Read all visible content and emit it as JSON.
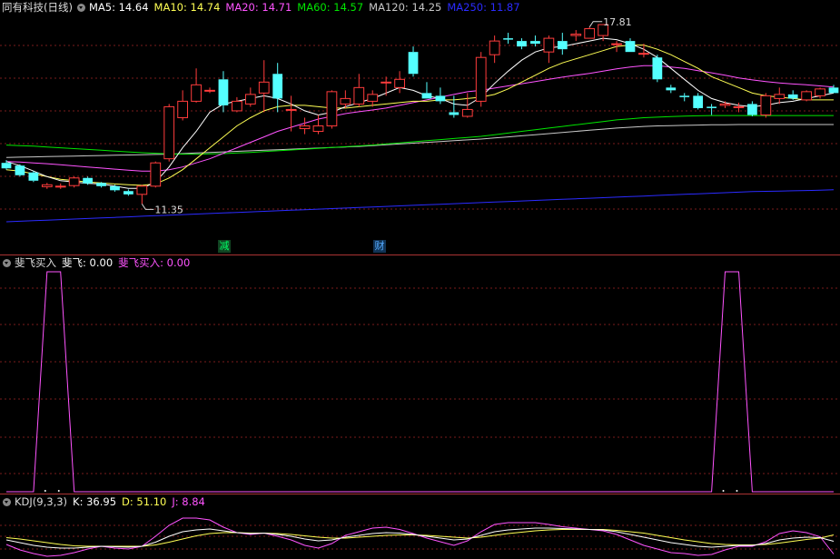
{
  "colors": {
    "bg": "#000000",
    "up": "#ff3c3c",
    "down": "#54ffff",
    "ma5": "#ffffff",
    "ma10": "#ffff54",
    "ma20": "#ff54ff",
    "ma60": "#00e600",
    "ma120": "#c8c8c8",
    "ma250": "#2b2bff",
    "grid": "#7a1d1d",
    "k": "#ffffff",
    "d": "#ffff54",
    "j": "#ff54ff"
  },
  "main": {
    "title": "同有科技(日线)",
    "ma_labels": [
      {
        "text": "MA5: 14.64",
        "color": "#ffffff"
      },
      {
        "text": "MA10: 14.74",
        "color": "#ffff54"
      },
      {
        "text": "MA20: 14.71",
        "color": "#ff54ff"
      },
      {
        "text": "MA60: 14.57",
        "color": "#00e600"
      },
      {
        "text": "MA120: 14.25",
        "color": "#c8c8c8"
      },
      {
        "text": "MA250: 11.87",
        "color": "#2b2bff"
      }
    ],
    "high_label": "17.81",
    "low_label": "11.35",
    "event_tags": [
      {
        "text": "减",
        "color": "#00ff66",
        "bg": "#114422"
      },
      {
        "text": "财",
        "color": "#54aaff",
        "bg": "#113355"
      }
    ]
  },
  "indicator1": {
    "name": "斐飞买入",
    "labels": [
      {
        "text": "斐飞: 0.00",
        "color": "#ffffff"
      },
      {
        "text": "斐飞买入: 0.00",
        "color": "#ff54ff"
      }
    ]
  },
  "indicator2": {
    "name": "KDJ(9,3,3)",
    "labels": [
      {
        "text": "K: 36.95",
        "color": "#ffffff"
      },
      {
        "text": "D: 51.10",
        "color": "#ffff54"
      },
      {
        "text": "J: 8.84",
        "color": "#ff54ff"
      }
    ]
  },
  "chart_data": {
    "type": "candlestick",
    "ylim": [
      10.5,
      18.2
    ],
    "high": 17.81,
    "low": 11.35,
    "candles": [
      [
        12.85,
        12.95,
        12.6,
        12.65
      ],
      [
        12.75,
        12.8,
        12.35,
        12.4
      ],
      [
        12.5,
        12.55,
        12.15,
        12.2
      ],
      [
        11.98,
        12.12,
        11.9,
        12.05
      ],
      [
        11.98,
        12.1,
        11.9,
        12.0
      ],
      [
        12.02,
        12.35,
        11.95,
        12.3
      ],
      [
        12.3,
        12.35,
        12.05,
        12.1
      ],
      [
        12.12,
        12.15,
        11.95,
        12.0
      ],
      [
        12.0,
        12.05,
        11.8,
        11.85
      ],
      [
        11.82,
        11.88,
        11.65,
        11.7
      ],
      [
        11.7,
        12.05,
        11.35,
        12.0
      ],
      [
        12.0,
        12.9,
        11.95,
        12.85
      ],
      [
        13.0,
        15.0,
        12.9,
        14.9
      ],
      [
        14.5,
        15.5,
        14.4,
        15.1
      ],
      [
        15.1,
        16.3,
        15.05,
        15.7
      ],
      [
        15.5,
        15.6,
        15.4,
        15.5
      ],
      [
        15.9,
        16.2,
        14.7,
        14.95
      ],
      [
        14.75,
        15.25,
        14.7,
        15.1
      ],
      [
        15.0,
        15.6,
        14.9,
        15.35
      ],
      [
        15.4,
        16.6,
        14.7,
        15.8
      ],
      [
        16.1,
        16.5,
        14.7,
        15.2
      ],
      [
        14.8,
        15.3,
        14.0,
        14.8
      ],
      [
        14.1,
        14.5,
        13.9,
        14.2
      ],
      [
        14.0,
        14.6,
        13.9,
        14.2
      ],
      [
        14.2,
        15.5,
        14.1,
        15.45
      ],
      [
        15.0,
        15.5,
        14.85,
        15.2
      ],
      [
        15.0,
        16.1,
        14.9,
        15.6
      ],
      [
        15.1,
        15.5,
        14.9,
        15.35
      ],
      [
        15.8,
        16.0,
        15.3,
        15.8
      ],
      [
        15.6,
        16.2,
        15.4,
        15.9
      ],
      [
        16.9,
        17.1,
        16.0,
        16.1
      ],
      [
        15.4,
        15.8,
        15.2,
        15.2
      ],
      [
        15.3,
        15.6,
        15.0,
        15.1
      ],
      [
        14.7,
        15.3,
        14.5,
        14.6
      ],
      [
        14.55,
        15.4,
        14.5,
        14.8
      ],
      [
        15.1,
        16.9,
        14.9,
        16.7
      ],
      [
        16.8,
        17.5,
        16.5,
        17.3
      ],
      [
        17.4,
        17.6,
        17.2,
        17.35
      ],
      [
        17.3,
        17.4,
        17.0,
        17.1
      ],
      [
        17.3,
        17.5,
        17.1,
        17.2
      ],
      [
        16.9,
        17.5,
        16.5,
        17.4
      ],
      [
        17.3,
        17.6,
        16.8,
        17.0
      ],
      [
        17.5,
        17.7,
        17.3,
        17.55
      ],
      [
        17.4,
        17.81,
        17.4,
        17.75
      ],
      [
        17.5,
        17.75,
        17.3,
        17.9
      ],
      [
        17.2,
        17.3,
        16.9,
        17.2
      ],
      [
        17.3,
        17.4,
        16.9,
        16.9
      ],
      [
        16.85,
        17.2,
        16.7,
        16.85
      ],
      [
        16.7,
        16.8,
        15.8,
        15.9
      ],
      [
        15.6,
        15.7,
        15.4,
        15.5
      ],
      [
        15.3,
        15.4,
        15.1,
        15.25
      ],
      [
        15.3,
        15.4,
        14.8,
        14.85
      ],
      [
        14.9,
        15.0,
        14.6,
        14.85
      ],
      [
        14.95,
        15.1,
        14.85,
        15.0
      ],
      [
        14.9,
        15.05,
        14.7,
        14.9
      ],
      [
        15.0,
        15.1,
        14.55,
        14.6
      ],
      [
        14.6,
        15.4,
        14.5,
        15.3
      ],
      [
        15.2,
        15.6,
        15.0,
        15.35
      ],
      [
        15.35,
        15.5,
        15.15,
        15.2
      ],
      [
        15.15,
        15.5,
        15.1,
        15.45
      ],
      [
        15.3,
        15.6,
        15.2,
        15.55
      ],
      [
        15.6,
        15.7,
        15.4,
        15.4
      ]
    ],
    "ma5": [
      12.9,
      12.75,
      12.55,
      12.35,
      12.2,
      12.15,
      12.1,
      12.08,
      12.0,
      11.92,
      11.92,
      12.15,
      12.7,
      13.4,
      14.0,
      14.7,
      15.0,
      15.1,
      15.2,
      15.3,
      15.2,
      15.0,
      14.75,
      14.6,
      14.7,
      14.9,
      15.05,
      15.2,
      15.4,
      15.6,
      15.5,
      15.3,
      15.2,
      15.0,
      14.95,
      15.25,
      15.75,
      16.2,
      16.6,
      16.9,
      17.05,
      17.1,
      17.2,
      17.3,
      17.4,
      17.35,
      17.2,
      17.0,
      16.7,
      16.3,
      15.9,
      15.5,
      15.2,
      15.05,
      14.95,
      14.9,
      14.95,
      15.05,
      15.1,
      15.2,
      15.3,
      15.4
    ],
    "ma10": [
      12.6,
      12.55,
      12.45,
      12.35,
      12.25,
      12.2,
      12.15,
      12.12,
      12.08,
      12.05,
      12.03,
      12.08,
      12.3,
      12.6,
      13.0,
      13.4,
      13.8,
      14.2,
      14.5,
      14.75,
      14.9,
      14.95,
      14.95,
      14.9,
      14.85,
      14.85,
      14.9,
      14.95,
      15.0,
      15.05,
      15.1,
      15.1,
      15.15,
      15.15,
      15.2,
      15.25,
      15.35,
      15.55,
      15.8,
      16.05,
      16.3,
      16.5,
      16.65,
      16.8,
      16.95,
      17.1,
      17.15,
      17.15,
      17.0,
      16.8,
      16.55,
      16.3,
      16.0,
      15.8,
      15.6,
      15.4,
      15.3,
      15.25,
      15.2,
      15.15,
      15.15,
      15.15
    ],
    "ma20": [
      12.9,
      12.88,
      12.85,
      12.82,
      12.78,
      12.74,
      12.7,
      12.66,
      12.62,
      12.58,
      12.55,
      12.55,
      12.6,
      12.7,
      12.85,
      13.0,
      13.2,
      13.4,
      13.6,
      13.8,
      14.0,
      14.15,
      14.3,
      14.45,
      14.55,
      14.65,
      14.72,
      14.78,
      14.85,
      14.95,
      15.05,
      15.15,
      15.25,
      15.35,
      15.45,
      15.5,
      15.58,
      15.66,
      15.74,
      15.82,
      15.9,
      15.98,
      16.05,
      16.12,
      16.2,
      16.28,
      16.35,
      16.4,
      16.4,
      16.35,
      16.3,
      16.22,
      16.14,
      16.05,
      15.95,
      15.88,
      15.82,
      15.77,
      15.73,
      15.7,
      15.66,
      15.62
    ],
    "ma60": [
      13.5,
      13.48,
      13.46,
      13.43,
      13.4,
      13.37,
      13.34,
      13.31,
      13.28,
      13.25,
      13.22,
      13.2,
      13.18,
      13.17,
      13.17,
      13.18,
      13.19,
      13.21,
      13.23,
      13.26,
      13.29,
      13.32,
      13.35,
      13.38,
      13.41,
      13.44,
      13.47,
      13.5,
      13.54,
      13.58,
      13.62,
      13.66,
      13.7,
      13.74,
      13.78,
      13.82,
      13.88,
      13.94,
      14.0,
      14.06,
      14.12,
      14.18,
      14.24,
      14.3,
      14.36,
      14.42,
      14.46,
      14.5,
      14.52,
      14.54,
      14.56,
      14.57,
      14.58,
      14.58,
      14.58,
      14.58,
      14.58,
      14.58,
      14.58,
      14.58,
      14.58,
      14.58
    ],
    "ma120": [
      13.05,
      13.06,
      13.07,
      13.08,
      13.09,
      13.1,
      13.11,
      13.12,
      13.13,
      13.14,
      13.15,
      13.16,
      13.17,
      13.19,
      13.21,
      13.23,
      13.25,
      13.27,
      13.29,
      13.31,
      13.33,
      13.35,
      13.37,
      13.39,
      13.41,
      13.43,
      13.45,
      13.48,
      13.51,
      13.54,
      13.57,
      13.6,
      13.63,
      13.66,
      13.69,
      13.72,
      13.76,
      13.8,
      13.84,
      13.88,
      13.92,
      13.96,
      14.0,
      14.04,
      14.08,
      14.12,
      14.15,
      14.18,
      14.2,
      14.21,
      14.22,
      14.23,
      14.24,
      14.24,
      14.25,
      14.25,
      14.25,
      14.25,
      14.25,
      14.25,
      14.25,
      14.25
    ],
    "ma250": [
      10.7,
      10.72,
      10.74,
      10.76,
      10.78,
      10.8,
      10.82,
      10.84,
      10.86,
      10.88,
      10.9,
      10.92,
      10.94,
      10.96,
      10.98,
      11.0,
      11.02,
      11.04,
      11.06,
      11.08,
      11.1,
      11.12,
      11.14,
      11.16,
      11.18,
      11.2,
      11.22,
      11.24,
      11.26,
      11.28,
      11.3,
      11.32,
      11.34,
      11.36,
      11.38,
      11.4,
      11.42,
      11.44,
      11.46,
      11.48,
      11.5,
      11.52,
      11.54,
      11.56,
      11.58,
      11.6,
      11.62,
      11.64,
      11.66,
      11.68,
      11.7,
      11.72,
      11.74,
      11.76,
      11.78,
      11.8,
      11.81,
      11.82,
      11.83,
      11.84,
      11.85,
      11.87
    ],
    "signal": [
      0,
      0,
      0,
      100,
      100,
      0,
      0,
      0,
      0,
      0,
      0,
      0,
      0,
      0,
      0,
      0,
      0,
      0,
      0,
      0,
      0,
      0,
      0,
      0,
      0,
      0,
      0,
      0,
      0,
      0,
      0,
      0,
      0,
      0,
      0,
      0,
      0,
      0,
      0,
      0,
      0,
      0,
      0,
      0,
      0,
      0,
      0,
      0,
      0,
      0,
      0,
      0,
      0,
      100,
      100,
      0,
      0,
      0,
      0,
      0,
      0,
      0
    ],
    "kdj_k": [
      40,
      34,
      28,
      24,
      22,
      22,
      24,
      26,
      25,
      24,
      26,
      35,
      48,
      58,
      62,
      64,
      60,
      56,
      54,
      55,
      52,
      48,
      42,
      38,
      40,
      46,
      50,
      54,
      56,
      55,
      52,
      48,
      44,
      40,
      42,
      50,
      58,
      62,
      64,
      66,
      66,
      65,
      64,
      63,
      62,
      58,
      52,
      46,
      40,
      34,
      30,
      26,
      24,
      26,
      28,
      28,
      32,
      40,
      44,
      46,
      45,
      37
    ],
    "kdj_d": [
      45,
      42,
      38,
      34,
      30,
      27,
      26,
      26,
      26,
      26,
      26,
      29,
      35,
      42,
      49,
      54,
      56,
      56,
      55,
      55,
      54,
      52,
      49,
      46,
      44,
      44,
      46,
      48,
      50,
      51,
      51,
      50,
      48,
      46,
      44,
      46,
      50,
      54,
      57,
      60,
      62,
      63,
      63,
      63,
      63,
      61,
      58,
      55,
      50,
      45,
      40,
      36,
      32,
      30,
      29,
      29,
      30,
      33,
      37,
      41,
      44,
      51
    ],
    "kdj_j": [
      30,
      18,
      10,
      4,
      6,
      12,
      20,
      26,
      22,
      20,
      26,
      48,
      72,
      88,
      88,
      84,
      68,
      56,
      52,
      55,
      48,
      40,
      28,
      22,
      32,
      50,
      58,
      66,
      68,
      63,
      54,
      44,
      36,
      28,
      38,
      58,
      74,
      78,
      78,
      78,
      74,
      69,
      66,
      63,
      60,
      52,
      40,
      28,
      20,
      12,
      10,
      6,
      8,
      18,
      26,
      26,
      36,
      54,
      60,
      56,
      47,
      9
    ]
  }
}
